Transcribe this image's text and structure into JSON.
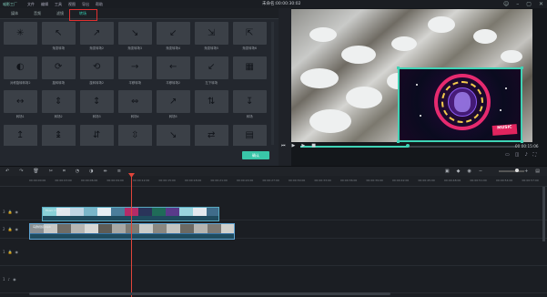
{
  "titlebar": {
    "logo": "喵影工厂",
    "menu": [
      "文件",
      "编辑",
      "工具",
      "视图",
      "导出",
      "帮助"
    ],
    "project_title": "未命名:00:00:30:02",
    "window_controls": [
      "user-icon",
      "minimize-icon",
      "restore-icon",
      "close-icon"
    ]
  },
  "tabs": {
    "items": [
      "媒体",
      "音频",
      "滤镜",
      "转场"
    ],
    "active_index": 3
  },
  "transitions": [
    "",
    "渐变转场",
    "渐变转场2",
    "渐变转场3",
    "渐变转场4",
    "渐变转场5",
    "渐变转场6",
    "对称旋转转场2",
    "旋转转场",
    "旋转转场2",
    "平移转场",
    "平移转场2",
    "左下转场",
    "",
    "转场1",
    "转场2",
    "转场3",
    "转场4",
    "转场5",
    "",
    "转场",
    "翻转1",
    "翻转2",
    "翻转3",
    "翻转4",
    "翻转5",
    "翻转6",
    ""
  ],
  "ok_button": "确认",
  "player": {
    "timecode": "00:00:15:06",
    "progress": 0.5,
    "controls": [
      "prev-frame-icon",
      "play-icon",
      "next-frame-icon",
      "stop-icon"
    ]
  },
  "pip_overlay": {
    "badge": "MUSIC"
  },
  "timeline": {
    "ruler": [
      "00:00:00:00",
      "00:00:03:00",
      "00:00:06:00",
      "00:00:09:00",
      "00:00:12:00",
      "00:00:15:00",
      "00:00:18:00",
      "00:00:21:00",
      "00:00:24:00",
      "00:00:27:00",
      "00:00:30:00",
      "00:00:33:00",
      "00:00:36:00",
      "00:00:39:00",
      "00:00:42:00",
      "00:00:45:00",
      "00:00:48:00",
      "00:00:51:00",
      "00:00:54:00",
      "00:00:57:00",
      "00:01:00:00"
    ],
    "tracks": [
      "3",
      "2",
      "1",
      "1"
    ],
    "clip_pip_label": "Music Cyber...",
    "clip_video_label": "鸟群视频.mp4"
  },
  "colors": {
    "accent": "#39c6a8",
    "highlight": "#e03030",
    "playhead": "#e0453a"
  }
}
